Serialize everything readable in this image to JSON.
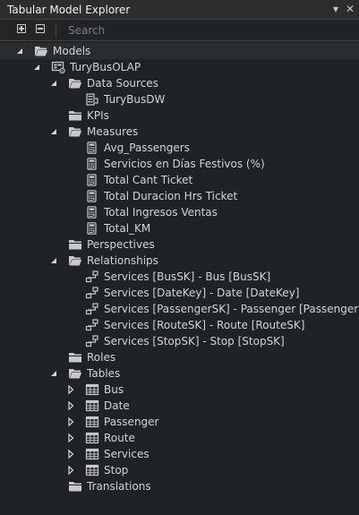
{
  "window": {
    "title": "Tabular Model Explorer"
  },
  "toolbar": {
    "search_placeholder": "Search"
  },
  "tree": [
    {
      "label": "Models",
      "level": 0,
      "expanded": true,
      "icon": "folder-open-icon"
    },
    {
      "label": "TuryBusOLAP",
      "level": 1,
      "expanded": true,
      "icon": "model-icon"
    },
    {
      "label": "Data Sources",
      "level": 2,
      "expanded": true,
      "icon": "folder-open-icon"
    },
    {
      "label": "TuryBusDW",
      "level": 3,
      "expanded": null,
      "icon": "datasource-icon"
    },
    {
      "label": "KPIs",
      "level": 2,
      "expanded": null,
      "icon": "folder-icon"
    },
    {
      "label": "Measures",
      "level": 2,
      "expanded": true,
      "icon": "folder-open-icon"
    },
    {
      "label": "Avg_Passengers",
      "level": 3,
      "expanded": null,
      "icon": "calculator-icon"
    },
    {
      "label": "Servicios en Días Festivos (%)",
      "level": 3,
      "expanded": null,
      "icon": "calculator-icon"
    },
    {
      "label": "Total Cant Ticket",
      "level": 3,
      "expanded": null,
      "icon": "calculator-icon"
    },
    {
      "label": "Total Duracion Hrs Ticket",
      "level": 3,
      "expanded": null,
      "icon": "calculator-icon"
    },
    {
      "label": "Total Ingresos Ventas",
      "level": 3,
      "expanded": null,
      "icon": "calculator-icon"
    },
    {
      "label": "Total_KM",
      "level": 3,
      "expanded": null,
      "icon": "calculator-icon"
    },
    {
      "label": "Perspectives",
      "level": 2,
      "expanded": null,
      "icon": "folder-icon"
    },
    {
      "label": "Relationships",
      "level": 2,
      "expanded": true,
      "icon": "folder-open-icon"
    },
    {
      "label": "Services [BusSK] - Bus [BusSK]",
      "level": 3,
      "expanded": null,
      "icon": "relationship-icon"
    },
    {
      "label": "Services [DateKey] - Date [DateKey]",
      "level": 3,
      "expanded": null,
      "icon": "relationship-icon"
    },
    {
      "label": "Services [PassengerSK] - Passenger [PassengerSK]",
      "level": 3,
      "expanded": null,
      "icon": "relationship-icon"
    },
    {
      "label": "Services [RouteSK] - Route [RouteSK]",
      "level": 3,
      "expanded": null,
      "icon": "relationship-icon"
    },
    {
      "label": "Services [StopSK] - Stop [StopSK]",
      "level": 3,
      "expanded": null,
      "icon": "relationship-icon"
    },
    {
      "label": "Roles",
      "level": 2,
      "expanded": null,
      "icon": "folder-icon"
    },
    {
      "label": "Tables",
      "level": 2,
      "expanded": true,
      "icon": "folder-open-icon"
    },
    {
      "label": "Bus",
      "level": 3,
      "expanded": false,
      "icon": "table-icon"
    },
    {
      "label": "Date",
      "level": 3,
      "expanded": false,
      "icon": "table-icon"
    },
    {
      "label": "Passenger",
      "level": 3,
      "expanded": false,
      "icon": "table-icon"
    },
    {
      "label": "Route",
      "level": 3,
      "expanded": false,
      "icon": "table-icon"
    },
    {
      "label": "Services",
      "level": 3,
      "expanded": false,
      "icon": "table-icon"
    },
    {
      "label": "Stop",
      "level": 3,
      "expanded": false,
      "icon": "table-icon"
    },
    {
      "label": "Translations",
      "level": 2,
      "expanded": null,
      "icon": "folder-icon"
    }
  ]
}
